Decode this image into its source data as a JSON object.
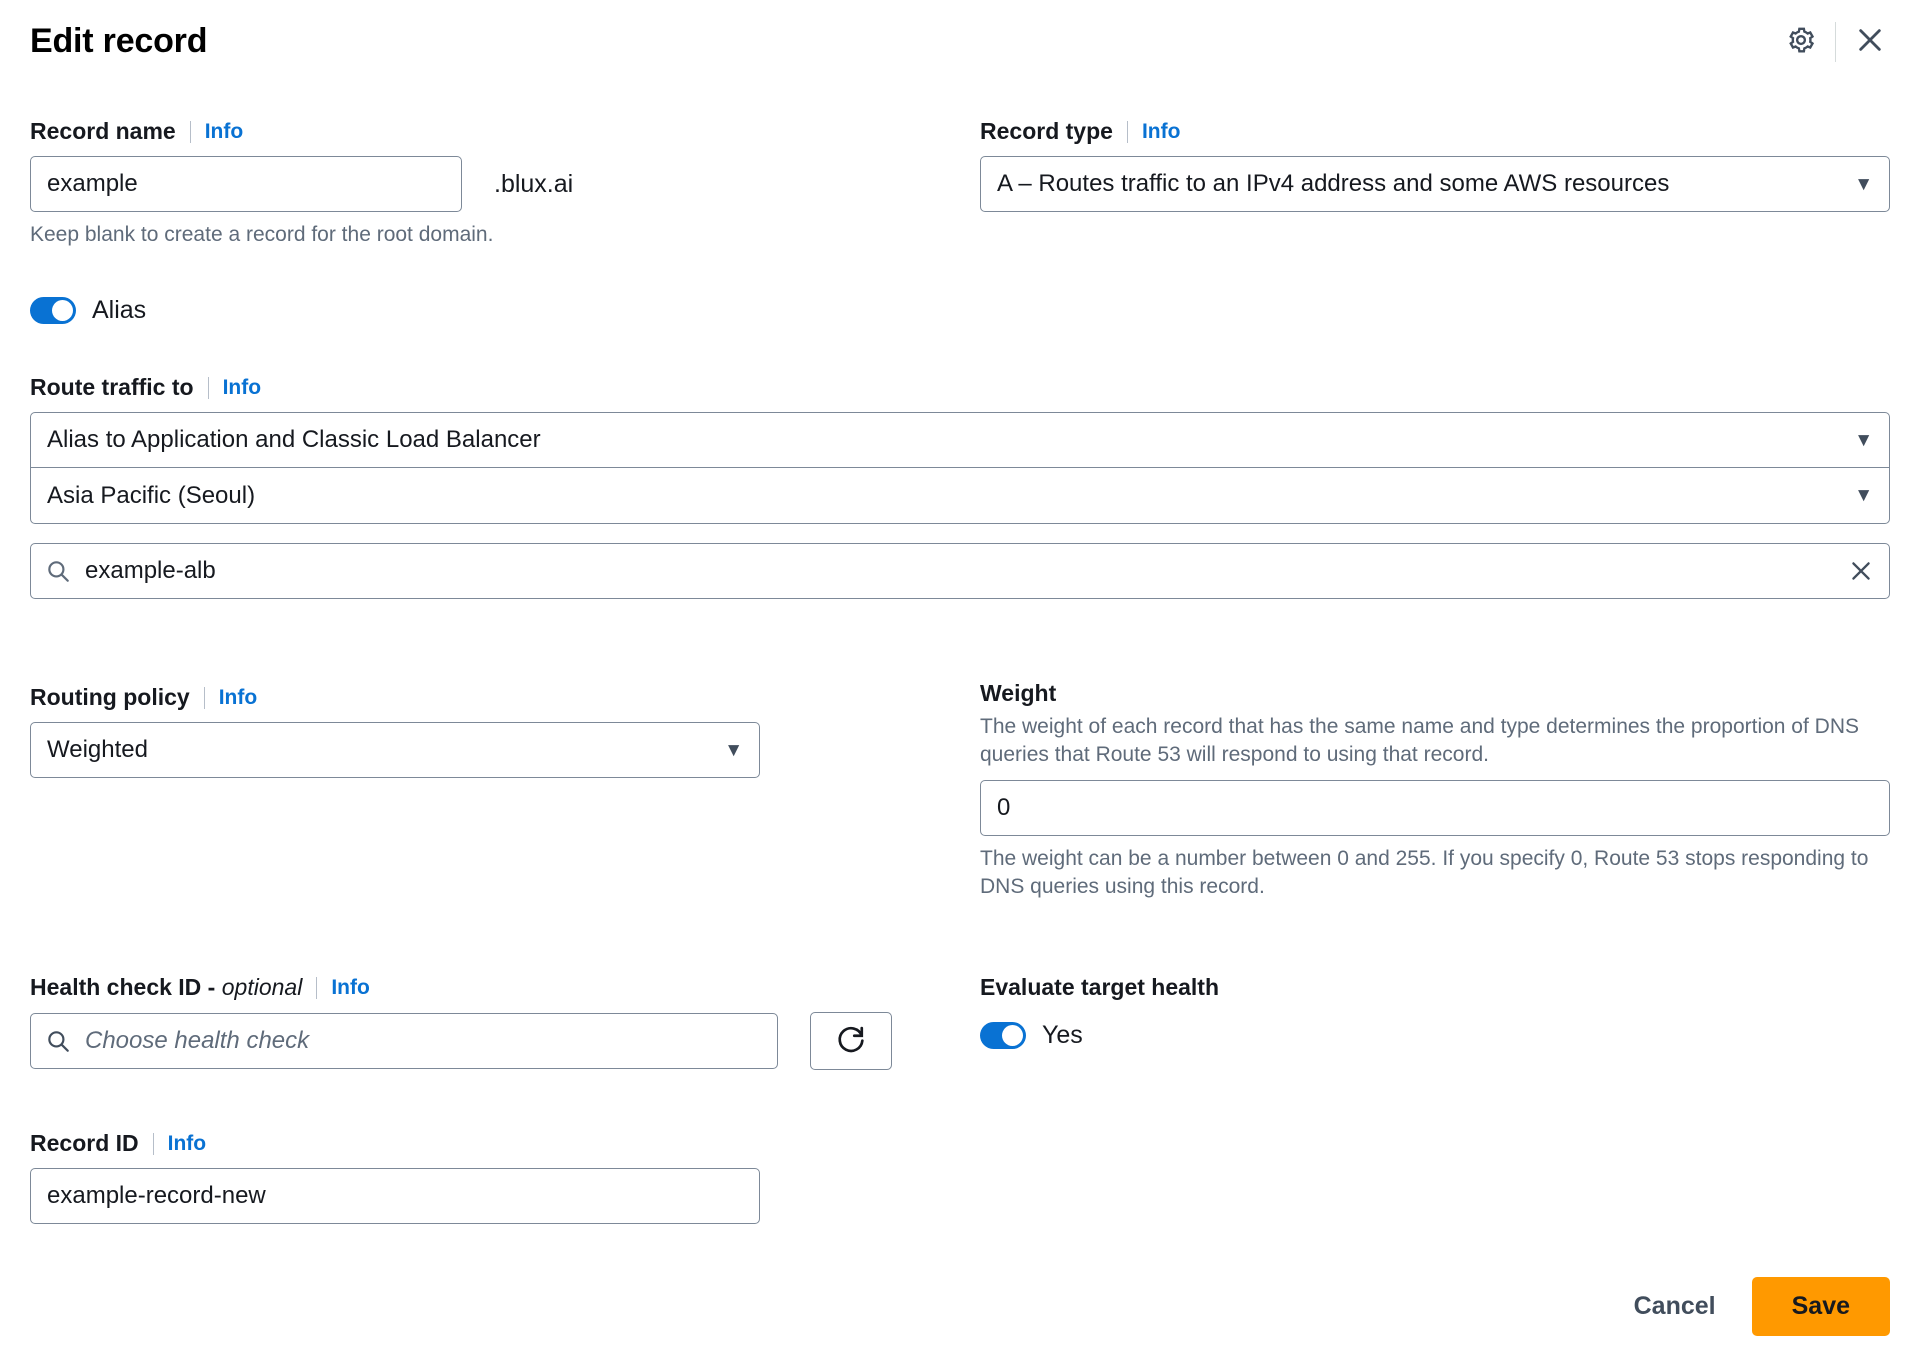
{
  "header": {
    "title": "Edit record",
    "settings_icon": "gear-icon",
    "close_icon": "close-icon"
  },
  "info_label": "Info",
  "record_name": {
    "label": "Record name",
    "value": "example",
    "domain_suffix": ".blux.ai",
    "hint": "Keep blank to create a record for the root domain."
  },
  "record_type": {
    "label": "Record type",
    "value": "A – Routes traffic to an IPv4 address and some AWS resources",
    "caret": "▼"
  },
  "alias": {
    "label": "Alias",
    "enabled": true
  },
  "route_traffic": {
    "label": "Route traffic to",
    "target_type": "Alias to Application and Classic Load Balancer",
    "region": "Asia Pacific (Seoul)",
    "resource_value": "example-alb",
    "search_icon": "search-icon",
    "clear_icon": "clear-icon",
    "caret": "▼"
  },
  "routing_policy": {
    "label": "Routing policy",
    "value": "Weighted",
    "caret": "▼"
  },
  "weight": {
    "label": "Weight",
    "description": "The weight of each record that has the same name and type determines the proportion of DNS queries that Route 53 will respond to using that record.",
    "value": "0",
    "hint": "The weight can be a number between 0 and 255. If you specify 0, Route 53 stops responding to DNS queries using this record."
  },
  "health_check": {
    "label": "Health check ID - ",
    "label_optional": "optional",
    "placeholder": "Choose health check",
    "value": "",
    "search_icon": "search-icon",
    "refresh_icon": "refresh-icon"
  },
  "evaluate_target_health": {
    "label": "Evaluate target health",
    "toggle_label": "Yes",
    "enabled": true
  },
  "record_id": {
    "label": "Record ID",
    "value": "example-record-new"
  },
  "footer": {
    "cancel_label": "Cancel",
    "save_label": "Save"
  },
  "colors": {
    "accent_blue": "#0972d3",
    "save_orange": "#ff9900",
    "border_gray": "#7d8998",
    "hint_gray": "#5f6b7a"
  }
}
